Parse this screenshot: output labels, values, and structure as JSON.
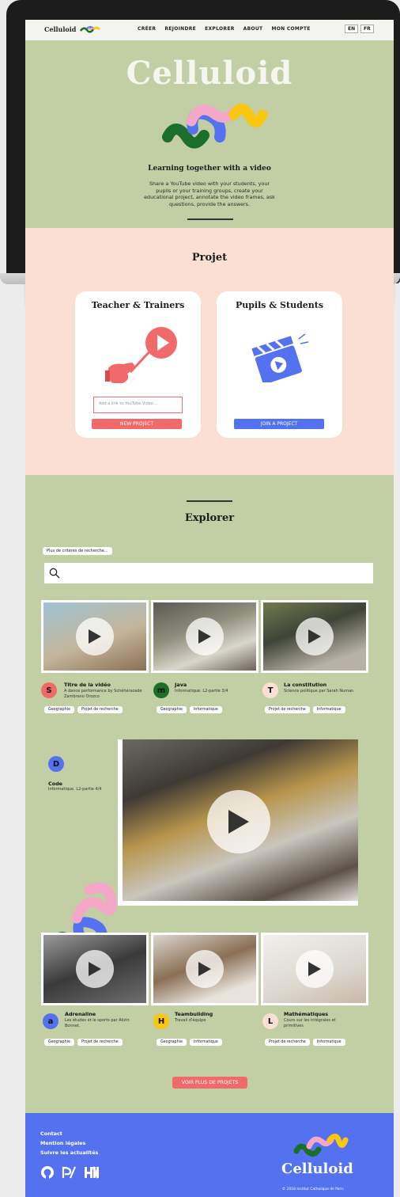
{
  "nav": {
    "logo": "Celluloid",
    "items": [
      "CRÉER",
      "REJOINDRE",
      "EXPLORER",
      "ABOUT",
      "MON COMPTE"
    ],
    "lang_en": "EN",
    "lang_fr": "FR"
  },
  "hero": {
    "title": "Celluloid",
    "subtitle": "Learning together with a video",
    "description": "Share a YouTube video with your students, your pupils or your training groups, create your educational project, annotate the video frames, ask questions, provide the answers."
  },
  "projet": {
    "title": "Projet",
    "teacher": {
      "title": "Teacher & Trainers",
      "input_placeholder": "Add a link to YouTube Video...",
      "button": "NEW PROJECT"
    },
    "students": {
      "title": "Pupils & Students",
      "button": "JOIN A PROJECT"
    }
  },
  "explorer": {
    "title": "Explorer",
    "criteria_button": "Plus de critères de recherche...",
    "search_value": "",
    "videos": [
      {
        "letter": "S",
        "color": "#f06a6a",
        "title": "Titre de la vidéo",
        "desc": "A dance performance by Schéhérazade Zambrano Orozco",
        "tags": [
          "Geographie",
          "Projet de recherche"
        ]
      },
      {
        "letter": "m",
        "color": "#1c6e2b",
        "title": "Java",
        "desc": "Informatique. L2-partie 3/4",
        "tags": [
          "Geographie",
          "Informatique"
        ]
      },
      {
        "letter": "T",
        "color": "#fbdfd2",
        "title": "La constitution",
        "desc": "Science politique par Sarah Numan",
        "tags": [
          "Projet de recherche",
          "Informatique"
        ]
      },
      {
        "letter": "a",
        "color": "#5471f0",
        "title": "Adrenaline",
        "desc": "Les études et le sports par Alizin Bonnet.",
        "tags": [
          "Geographie",
          "Projet de recherche"
        ]
      },
      {
        "letter": "H",
        "color": "#f9c80e",
        "title": "Teambuilding",
        "desc": "Travail d'équipe",
        "tags": [
          "Geographie",
          "Informatique"
        ]
      },
      {
        "letter": "L",
        "color": "#fbdfd2",
        "title": "Mathématiques",
        "desc": "Cours sur les intégrales et primitives",
        "tags": [
          "Projet de recherche",
          "Informatique"
        ]
      }
    ],
    "featured": {
      "letter": "D",
      "color": "#5471f0",
      "title": "Code",
      "desc": "Informatique. L2-partie 4/4"
    },
    "more_button": "VOIR PLUS DE PROJETS"
  },
  "footer": {
    "links": [
      "Contact",
      "Mention légales",
      "Suivre les actualités"
    ],
    "icons": [
      "github-icon",
      "p2-icon",
      "hacker-news-icon"
    ],
    "logo": "Celluloid",
    "copyright": "© 2018 Institut Catholique de Paris"
  }
}
